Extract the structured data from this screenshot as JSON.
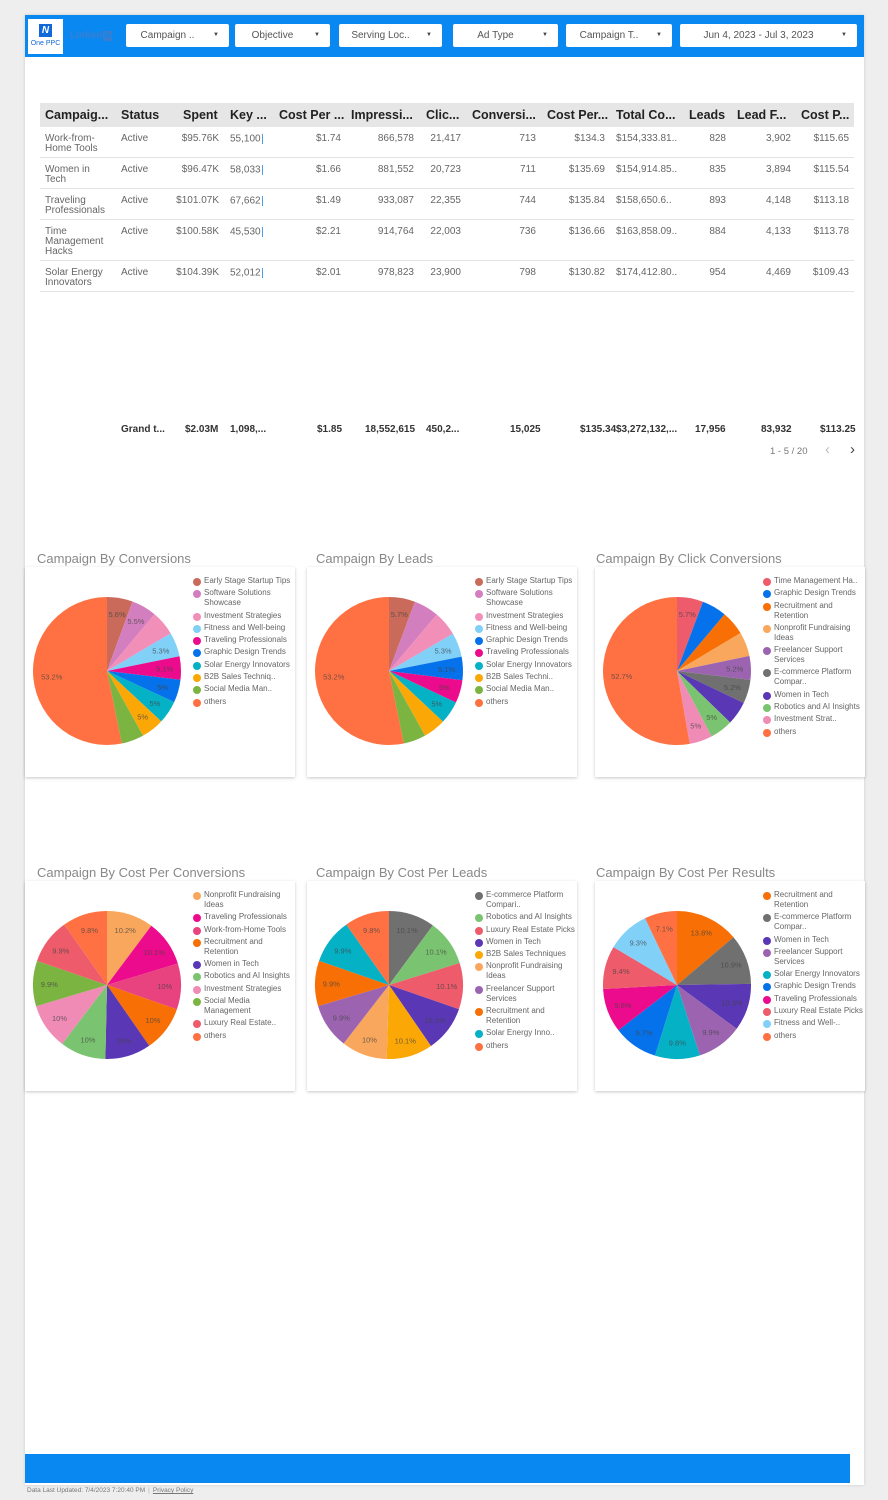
{
  "header": {
    "logo_text": "One PPC",
    "logo_mark": "N",
    "platform_text": "Linked",
    "platform_badge": "in",
    "filters": [
      {
        "label": "Campaign ..",
        "name": "campaign-filter"
      },
      {
        "label": "Objective",
        "name": "objective-filter"
      },
      {
        "label": "Serving Loc..",
        "name": "serving-location-filter"
      },
      {
        "label": "Ad Type",
        "name": "ad-type-filter"
      },
      {
        "label": "Campaign T..",
        "name": "campaign-type-filter"
      },
      {
        "label": "Jun 4, 2023 - Jul 3, 2023",
        "name": "date-range-filter"
      }
    ],
    "caret": "▼"
  },
  "table": {
    "columns": [
      "Campaig...",
      "Status",
      "Spent",
      "Key ...",
      "Cost Per ...",
      "Impressi...",
      "Clic...",
      "Conversi...",
      "Cost Per...",
      "Total Co...",
      "Leads",
      "Lead F...",
      "Cost P..."
    ],
    "rows": [
      [
        "Work-from-Home Tools",
        "Active",
        "$95.76K",
        "55,100",
        "$1.74",
        "866,578",
        "21,417",
        "713",
        "$134.3",
        "$154,333.81..",
        "828",
        "3,902",
        "$115.65"
      ],
      [
        "Women in Tech",
        "Active",
        "$96.47K",
        "58,033",
        "$1.66",
        "881,552",
        "20,723",
        "711",
        "$135.69",
        "$154,914.85..",
        "835",
        "3,894",
        "$115.54"
      ],
      [
        "Traveling Professionals",
        "Active",
        "$101.07K",
        "67,662",
        "$1.49",
        "933,087",
        "22,355",
        "744",
        "$135.84",
        "$158,650.6..",
        "893",
        "4,148",
        "$113.18"
      ],
      [
        "Time Management Hacks",
        "Active",
        "$100.58K",
        "45,530",
        "$2.21",
        "914,764",
        "22,003",
        "736",
        "$136.66",
        "$163,858.09..",
        "884",
        "4,133",
        "$113.78"
      ],
      [
        "Solar Energy Innovators",
        "Active",
        "$104.39K",
        "52,012",
        "$2.01",
        "978,823",
        "23,900",
        "798",
        "$130.82",
        "$174,412.80..",
        "954",
        "4,469",
        "$109.43"
      ]
    ],
    "grand_total": [
      "Grand t...",
      "$2.03M",
      "1,098,...",
      "$1.85",
      "18,552,615",
      "450,2...",
      "15,025",
      "$135.34",
      "$3,272,132,...",
      "17,956",
      "83,932",
      "$113.25"
    ],
    "pagination": "1 - 5 / 20",
    "prev_icon": "‹",
    "next_icon": "›"
  },
  "chart_data": [
    {
      "type": "pie",
      "title": "Campaign By Conversions",
      "legend_position": "right",
      "labels": [
        "Early Stage Startup Tips",
        "Software Solutions Showcase",
        "Investment Strategies",
        "Fitness and Well-being",
        "Traveling Professionals",
        "Graphic Design Trends",
        "Solar Energy Innovators",
        "B2B Sales Techniq..",
        "Social Media Man..",
        "others"
      ],
      "values": [
        5.6,
        5.5,
        5.4,
        5.3,
        5.1,
        5.0,
        5.0,
        5.0,
        4.9,
        53.2
      ],
      "shown_labels": [
        "5.6%",
        "5.5%",
        "",
        "5.3%",
        "5.1%",
        "5%",
        "5%",
        "5%",
        "",
        "53.2%"
      ],
      "colors": [
        "#c96a5a",
        "#d37fbf",
        "#f28fb8",
        "#80d0f8",
        "#ec0b8c",
        "#0572ec",
        "#05b1c5",
        "#fba705",
        "#7cb442",
        "#ff7142"
      ]
    },
    {
      "type": "pie",
      "title": "Campaign By Leads",
      "legend_position": "right",
      "labels": [
        "Early Stage Startup Tips",
        "Software Solutions Showcase",
        "Investment Strategies",
        "Fitness and Well-being",
        "Graphic Design Trends",
        "Traveling Professionals",
        "Solar Energy Innovators",
        "B2B Sales Techni..",
        "Social Media Man..",
        "others"
      ],
      "values": [
        5.7,
        5.5,
        5.4,
        5.3,
        5.1,
        5.0,
        5.0,
        4.9,
        4.9,
        53.2
      ],
      "shown_labels": [
        "5.7%",
        "",
        "",
        "5.3%",
        "5.1%",
        "5%",
        "5%",
        "",
        "",
        "53.2%"
      ],
      "colors": [
        "#c96a5a",
        "#d37fbf",
        "#f28fb8",
        "#80d0f8",
        "#0572ec",
        "#ec0b8c",
        "#05b1c5",
        "#fba705",
        "#7cb442",
        "#ff7142"
      ]
    },
    {
      "type": "pie",
      "title": "Campaign By Click Conversions",
      "legend_position": "right",
      "labels": [
        "Time Management Ha..",
        "Graphic Design Trends",
        "Recruitment and Retention",
        "Nonprofit Fundraising Ideas",
        "Freelancer Support Services",
        "E-commerce Platform Compar..",
        "Women in Tech",
        "Robotics and AI Insights",
        "Investment Strat..",
        "others"
      ],
      "values": [
        5.7,
        5.4,
        5.3,
        5.3,
        5.2,
        5.2,
        5.1,
        5.0,
        5.0,
        52.7
      ],
      "shown_labels": [
        "5.7%",
        "",
        "",
        "",
        "5.2%",
        "5.2%",
        "",
        "5%",
        "5%",
        "52.7%"
      ],
      "colors": [
        "#ee5b6b",
        "#0572ec",
        "#f76f05",
        "#f9a75c",
        "#9c64b0",
        "#707070",
        "#5a37b5",
        "#7ac471",
        "#f08bb5",
        "#ff7142"
      ]
    },
    {
      "type": "pie",
      "title": "Campaign By Cost Per Conversions",
      "legend_position": "right",
      "labels": [
        "Nonprofit Fundraising Ideas",
        "Traveling Professionals",
        "Work-from-Home Tools",
        "Recruitment and Retention",
        "Women in Tech",
        "Robotics and AI Insights",
        "Investment Strategies",
        "Social Media Management",
        "Luxury Real Estate..",
        "others"
      ],
      "values": [
        10.2,
        10.1,
        10.0,
        10.0,
        10.0,
        10.0,
        10.0,
        9.9,
        9.9,
        9.8
      ],
      "shown_labels": [
        "10.2%",
        "10.1%",
        "10%",
        "10%",
        "10%",
        "10%",
        "10%",
        "9.9%",
        "9.9%",
        "9.8%"
      ],
      "colors": [
        "#f9a75c",
        "#ec0b8c",
        "#e8427f",
        "#f76f05",
        "#5a37b5",
        "#7ac471",
        "#f08bb5",
        "#7cb442",
        "#ee5b6b",
        "#ff7142"
      ]
    },
    {
      "type": "pie",
      "title": "Campaign By Cost Per Leads",
      "legend_position": "right",
      "labels": [
        "E-commerce Platform Compari..",
        "Robotics and AI Insights",
        "Luxury Real Estate Picks",
        "Women in Tech",
        "B2B Sales Techniques",
        "Nonprofit Fundraising Ideas",
        "Freelancer Support Services",
        "Recruitment and Retention",
        "Solar Energy Inno..",
        "others"
      ],
      "values": [
        10.1,
        10.1,
        10.1,
        10.1,
        10.1,
        10.0,
        9.9,
        9.9,
        9.9,
        9.8
      ],
      "shown_labels": [
        "10.1%",
        "10.1%",
        "10.1%",
        "10.1%",
        "10.1%",
        "10%",
        "9.9%",
        "9.9%",
        "9.9%",
        "9.8%"
      ],
      "colors": [
        "#707070",
        "#7ac471",
        "#ee5b6b",
        "#5a37b5",
        "#fba705",
        "#f9a75c",
        "#9c64b0",
        "#f76f05",
        "#05b1c5",
        "#ff7142"
      ]
    },
    {
      "type": "pie",
      "title": "Campaign By Cost Per Results",
      "legend_position": "right",
      "labels": [
        "Recruitment and Retention",
        "E-commerce Platform Compar..",
        "Women in Tech",
        "Freelancer Support Services",
        "Solar Energy Innovators",
        "Graphic Design Trends",
        "Traveling Professionals",
        "Luxury Real Estate Picks",
        "Fitness and Well-..",
        "others"
      ],
      "values": [
        13.8,
        10.9,
        10.3,
        9.9,
        9.8,
        9.7,
        9.6,
        9.4,
        9.3,
        7.1
      ],
      "shown_labels": [
        "13.8%",
        "10.9%",
        "10.3%",
        "9.9%",
        "9.8%",
        "9.7%",
        "9.6%",
        "9.4%",
        "9.3%",
        "7.1%"
      ],
      "colors": [
        "#f76f05",
        "#707070",
        "#5a37b5",
        "#9c64b0",
        "#05b1c5",
        "#0572ec",
        "#ec0b8c",
        "#ee5b6b",
        "#80d0f8",
        "#ff7142"
      ]
    }
  ],
  "footer": {
    "last_updated": "Data Last Updated: 7/4/2023 7:20:40 PM",
    "separator": "|",
    "privacy_link": "Privacy Policy"
  }
}
